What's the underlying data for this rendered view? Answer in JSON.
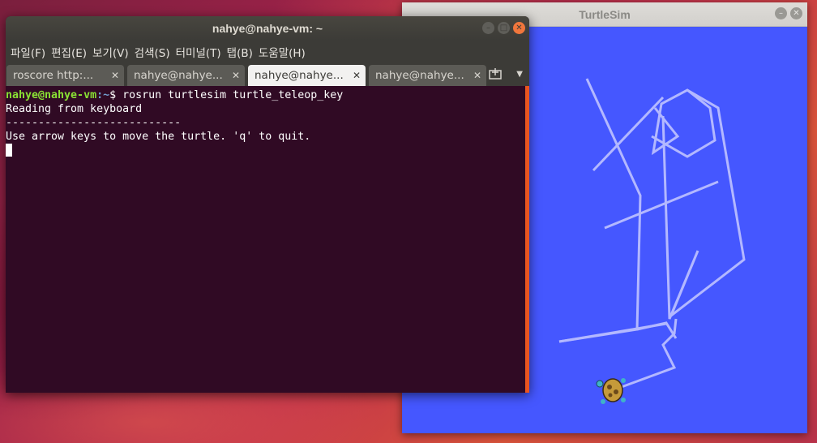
{
  "turtlesim": {
    "title": "TurtleSim",
    "background": "#4557ff",
    "path_color": "#b3b8ff"
  },
  "terminal": {
    "title": "nahye@nahye-vm: ~",
    "menu": [
      "파일(F)",
      "편집(E)",
      "보기(V)",
      "검색(S)",
      "터미널(T)",
      "탭(B)",
      "도움말(H)"
    ],
    "tabs": [
      {
        "label": "roscore http:..."
      },
      {
        "label": "nahye@nahye..."
      },
      {
        "label": "nahye@nahye...",
        "active": true
      },
      {
        "label": "nahye@nahye..."
      }
    ],
    "lines": {
      "prompt_user": "nahye@nahye-vm",
      "prompt_path": ":~",
      "command": "$ rosrun turtlesim turtle_teleop_key",
      "line2": "Reading from keyboard",
      "line3": "---------------------------",
      "line4": "Use arrow keys to move the turtle. 'q' to quit."
    },
    "accent": "#e95420"
  }
}
